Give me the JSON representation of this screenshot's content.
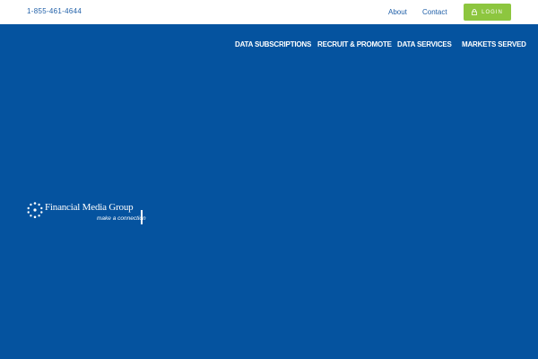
{
  "topbar": {
    "phone": "1-855-461-4644",
    "links": {
      "about": "About",
      "contact": "Contact"
    },
    "login": {
      "label": "LOGIN",
      "icon": "lock-icon",
      "color": "#8dc63f"
    }
  },
  "nav": {
    "items": [
      "DATA SUBSCRIPTIONS",
      "RECRUIT & PROMOTE",
      "DATA SERVICES",
      "MARKETS SERVED"
    ]
  },
  "brand": {
    "name": "Financial Media Group",
    "tagline": "make a connection",
    "background_color": "#05539f"
  }
}
